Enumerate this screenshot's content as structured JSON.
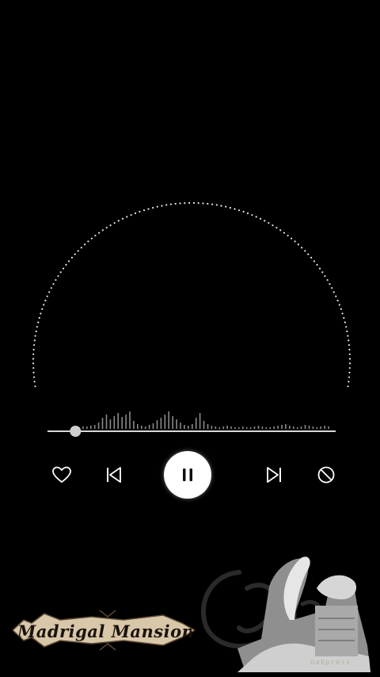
{
  "player": {
    "progress": 0.097,
    "state": "playing",
    "accent_color": "#ffffff",
    "background_color": "#000000"
  },
  "controls": {
    "like": {
      "icon": "heart-outline-icon"
    },
    "previous": {
      "icon": "skip-previous-icon"
    },
    "play_pause": {
      "icon": "pause-icon"
    },
    "next": {
      "icon": "skip-next-icon"
    },
    "block": {
      "icon": "block-icon"
    }
  },
  "watermark": {
    "banner_text": "Madrigal Mansion",
    "emblem": "gothic-script-monogram",
    "stamp_text": "oakpress"
  }
}
